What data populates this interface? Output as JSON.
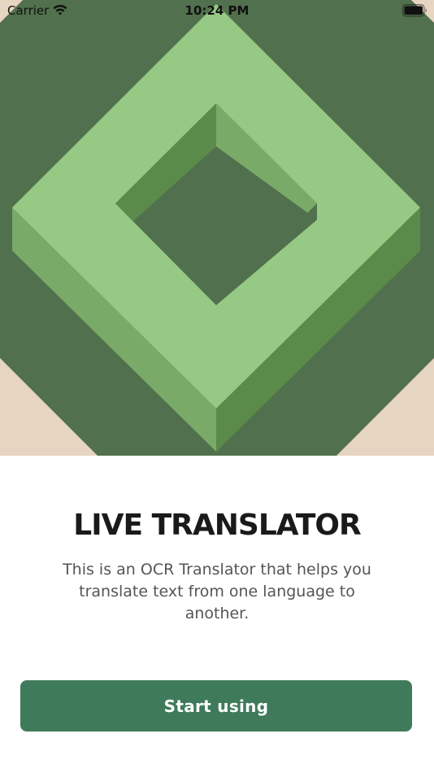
{
  "status_bar": {
    "carrier": "Carrier",
    "time": "10:24 PM",
    "icons": [
      "wifi-icon",
      "battery-icon"
    ]
  },
  "hero": {
    "illustration": "isometric-square-frame",
    "colors": {
      "background_dark_green": "#51704d",
      "frame_top_light": "#96c984",
      "frame_side_mid": "#79aa68",
      "frame_side_dark": "#5b8b4a",
      "corner_beige": "#e6d5c1",
      "corner_taupe": "#a89383"
    }
  },
  "onboarding": {
    "title": "LIVE TRANSLATOR",
    "description": "This is an OCR Translator that helps you translate text from one language to another.",
    "button_label": "Start using"
  },
  "colors": {
    "accent": "#3f7b5b",
    "title_text": "#1a1a1a",
    "body_text": "#555555"
  }
}
